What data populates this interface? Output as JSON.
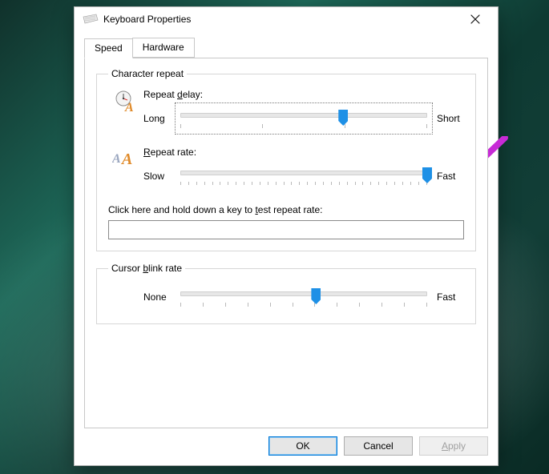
{
  "window": {
    "title": "Keyboard Properties"
  },
  "tabs": {
    "speed": "Speed",
    "hardware": "Hardware"
  },
  "groups": {
    "char_repeat": "Character repeat",
    "cursor_blink": "Cursor blink rate"
  },
  "char_repeat": {
    "delay_label_pre": "Repeat ",
    "delay_label_u": "d",
    "delay_label_post": "elay:",
    "delay_min": "Long",
    "delay_max": "Short",
    "delay_ticks": 4,
    "delay_value_percent": 66,
    "rate_label_u": "R",
    "rate_label_post": "epeat rate:",
    "rate_min": "Slow",
    "rate_max": "Fast",
    "rate_ticks": 32,
    "rate_value_percent": 100,
    "test_label_pre": "Click here and hold down a key to ",
    "test_label_u": "t",
    "test_label_post": "est repeat rate:",
    "test_value": ""
  },
  "cursor_blink": {
    "min": "None",
    "max": "Fast",
    "ticks": 12,
    "value_percent": 55
  },
  "buttons": {
    "ok": "OK",
    "cancel": "Cancel",
    "apply_u": "A",
    "apply_post": "pply"
  },
  "annotation": {
    "color": "#c72bd6"
  }
}
